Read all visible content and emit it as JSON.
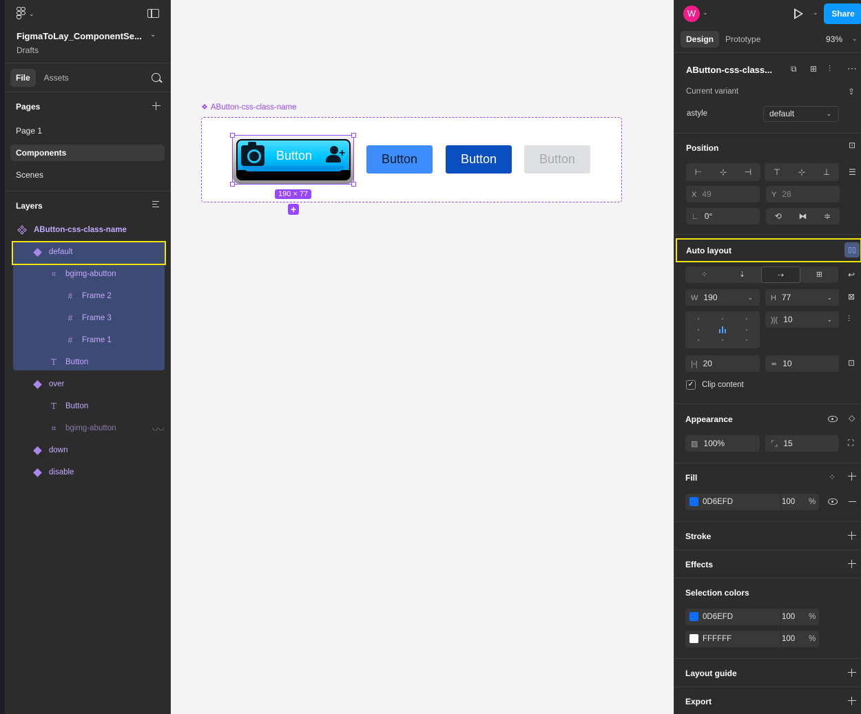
{
  "file": {
    "name": "FigmaToLay_ComponentSe...",
    "location": "Drafts"
  },
  "left_tabs": [
    "File",
    "Assets"
  ],
  "pages": {
    "title": "Pages",
    "items": [
      "Page 1",
      "Components",
      "Scenes"
    ],
    "selected": "Components"
  },
  "layers": {
    "title": "Layers",
    "root": "AButton-css-class-name",
    "items": [
      {
        "label": "default",
        "kind": "variant"
      },
      {
        "label": "bgimg-abutton",
        "kind": "frame-autolayout"
      },
      {
        "label": "Frame 2",
        "kind": "frame"
      },
      {
        "label": "Frame 3",
        "kind": "frame"
      },
      {
        "label": "Frame 1",
        "kind": "frame"
      },
      {
        "label": "Button",
        "kind": "text"
      },
      {
        "label": "over",
        "kind": "variant"
      },
      {
        "label": "Button",
        "kind": "text"
      },
      {
        "label": "bgimg-abutton",
        "kind": "frame-autolayout",
        "hidden": true
      },
      {
        "label": "down",
        "kind": "variant"
      },
      {
        "label": "disable",
        "kind": "variant"
      }
    ]
  },
  "canvas": {
    "set_label": "AButton-css-class-name",
    "buttons": {
      "default": "Button",
      "over": "Button",
      "down": "Button",
      "disable": "Button"
    },
    "size_badge": "190 × 77",
    "colors": {
      "selection": "#9747ff",
      "over": "#3d8dfd",
      "down": "#0a4ec0",
      "disable": "#dfe0e4"
    }
  },
  "header": {
    "avatar_initial": "W",
    "share_label": "Share",
    "tabs": [
      "Design",
      "Prototype"
    ],
    "zoom": "93%"
  },
  "design": {
    "selection_name": "AButton-css-class...",
    "current_variant_title": "Current variant",
    "variant_prop": "astyle",
    "variant_value": "default",
    "position": {
      "title": "Position",
      "x_label": "X",
      "x": "49",
      "y_label": "Y",
      "y": "28",
      "rotation": "0°"
    },
    "auto_layout": {
      "title": "Auto layout",
      "w_label": "W",
      "w": "190",
      "h_label": "H",
      "h": "77",
      "gap": "10",
      "padding_h": "20",
      "padding_v": "10",
      "clip_label": "Clip content",
      "clip_checked": true
    },
    "appearance": {
      "title": "Appearance",
      "opacity": "100%",
      "radius": "15"
    },
    "fill": {
      "title": "Fill",
      "hex": "0D6EFD",
      "color": "#0d6efd",
      "opacity": "100",
      "unit": "%"
    },
    "stroke_title": "Stroke",
    "effects_title": "Effects",
    "selection_colors": {
      "title": "Selection colors",
      "items": [
        {
          "hex": "0D6EFD",
          "color": "#0d6efd",
          "opacity": "100",
          "unit": "%"
        },
        {
          "hex": "FFFFFF",
          "color": "#ffffff",
          "opacity": "100",
          "unit": "%"
        }
      ]
    },
    "layout_guide_title": "Layout guide",
    "export_title": "Export"
  }
}
